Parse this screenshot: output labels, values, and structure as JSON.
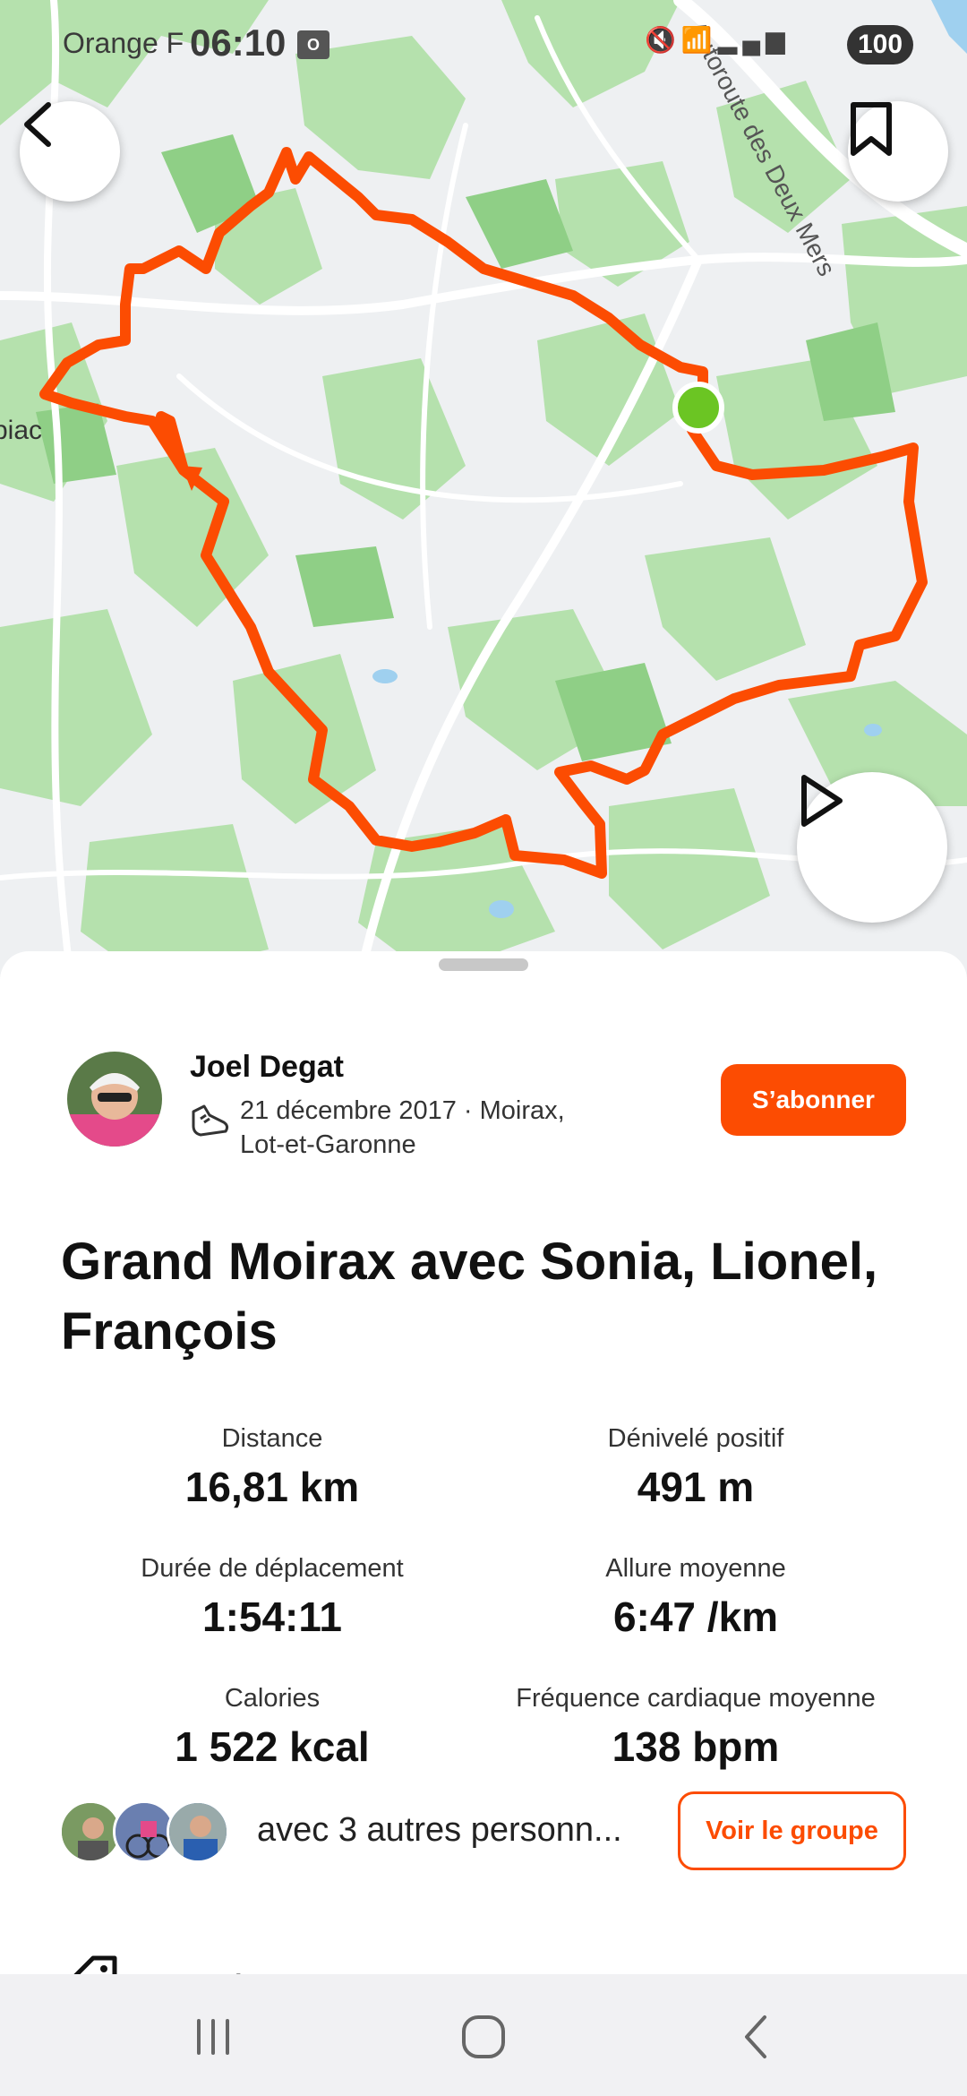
{
  "status_bar": {
    "carrier": "Orange F",
    "time": "06:10",
    "battery": "100"
  },
  "map": {
    "place_label": "piac",
    "road_label": "Autoroute des Deux Mers",
    "route_color": "#fc4c02",
    "start_marker_color": "#6bc523"
  },
  "activity": {
    "athlete_name": "Joel Degat",
    "date_location_line1": "21 décembre 2017 · Moirax,",
    "date_location_line2": "Lot-et-Garonne",
    "follow_label": "S’abonner",
    "title": "Grand Moirax avec Sonia, Lionel, François",
    "sport_icon": "running-shoe-icon"
  },
  "stats": {
    "distance": {
      "label": "Distance",
      "value": "16,81 km"
    },
    "elevation": {
      "label": "Dénivelé positif",
      "value": "491 m"
    },
    "moving_time": {
      "label": "Durée de déplacement",
      "value": "1:54:11"
    },
    "pace": {
      "label": "Allure moyenne",
      "value": "6:47 /km"
    },
    "calories": {
      "label": "Calories",
      "value": "1 522 kcal"
    },
    "heart_rate": {
      "label": "Fréquence cardiaque moyenne",
      "value": "138 bpm"
    }
  },
  "group": {
    "text": "avec 3 autres personn...",
    "button_label": "Voir le groupe"
  },
  "training": {
    "label": "Entraînement"
  },
  "colors": {
    "accent": "#fc4c02",
    "map_green": "#a9dba0",
    "map_base": "#eef0f2"
  }
}
